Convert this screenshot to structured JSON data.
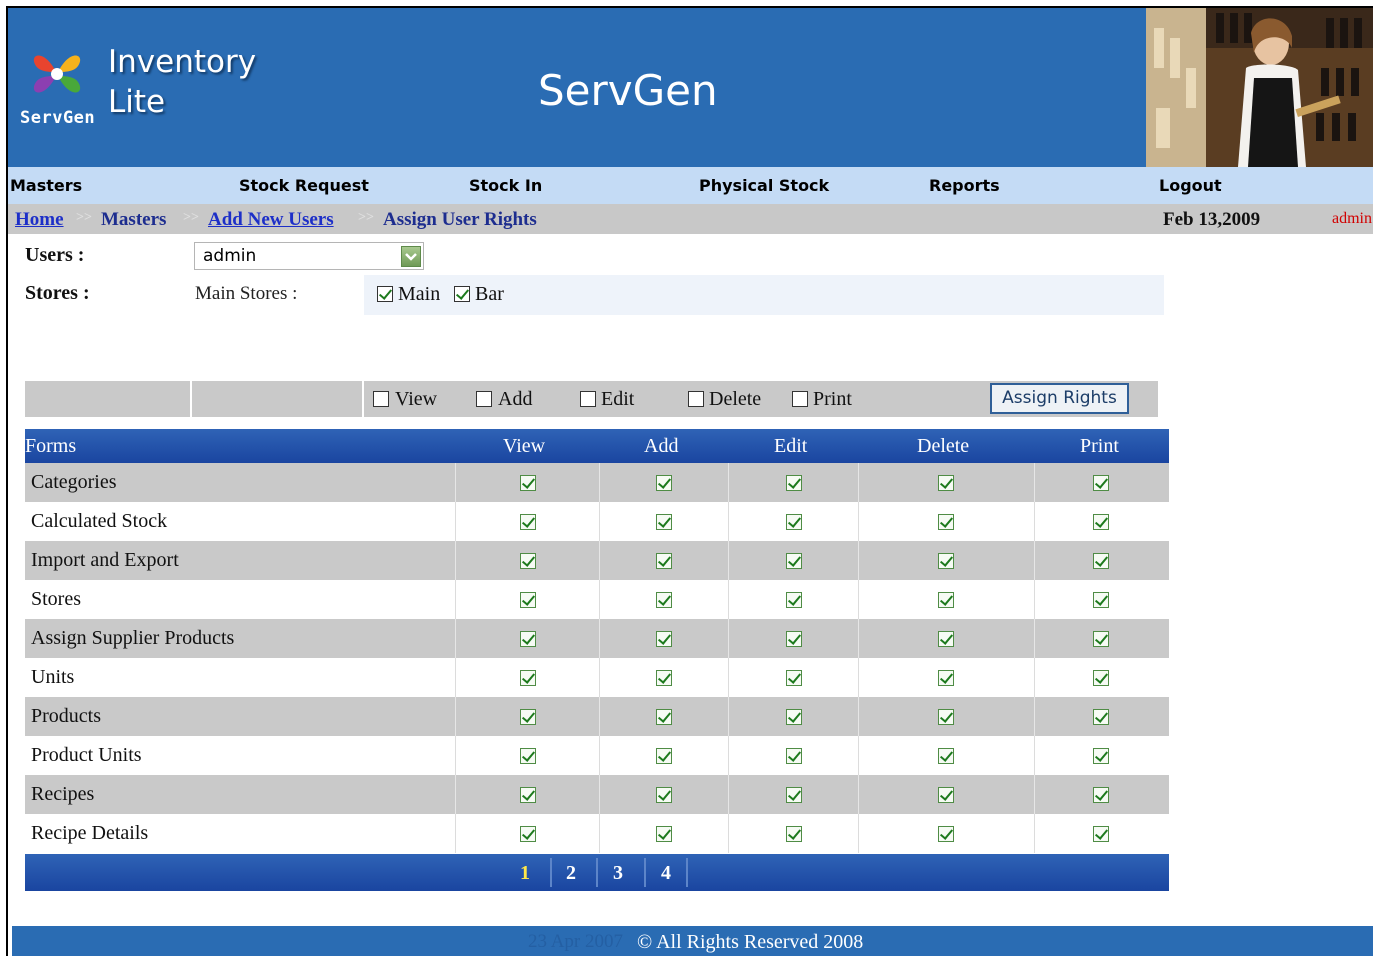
{
  "header": {
    "logo_brand": "ServGen",
    "product_line1": "Inventory",
    "product_line2": "Lite",
    "title": "ServGen"
  },
  "nav": {
    "items": [
      {
        "label": "Masters"
      },
      {
        "label": "Stock Request"
      },
      {
        "label": "Stock In"
      },
      {
        "label": "Physical Stock"
      },
      {
        "label": "Reports"
      },
      {
        "label": "Logout"
      }
    ]
  },
  "breadcrumb": {
    "home": "Home",
    "masters": "Masters",
    "add_new_users": "Add New Users",
    "current": "Assign User Rights",
    "separator": ">>",
    "date": "Feb 13,2009",
    "user": "admin"
  },
  "form": {
    "users_label": "Users :",
    "users_value": "admin",
    "stores_label": "Stores :",
    "main_stores_label": "Main Stores :",
    "stores": [
      {
        "label": "Main",
        "checked": true
      },
      {
        "label": "Bar",
        "checked": true
      }
    ]
  },
  "actions": {
    "view": "View",
    "add": "Add",
    "edit": "Edit",
    "delete": "Delete",
    "print": "Print",
    "assign_rights": "Assign Rights"
  },
  "table": {
    "headers": [
      "Forms",
      "View",
      "Add",
      "Edit",
      "Delete",
      "Print"
    ],
    "rows": [
      {
        "form": "Categories",
        "view": true,
        "add": true,
        "edit": true,
        "delete": true,
        "print": true
      },
      {
        "form": "Calculated Stock",
        "view": true,
        "add": true,
        "edit": true,
        "delete": true,
        "print": true
      },
      {
        "form": "Import and Export",
        "view": true,
        "add": true,
        "edit": true,
        "delete": true,
        "print": true
      },
      {
        "form": "Stores",
        "view": true,
        "add": true,
        "edit": true,
        "delete": true,
        "print": true
      },
      {
        "form": "Assign Supplier Products",
        "view": true,
        "add": true,
        "edit": true,
        "delete": true,
        "print": true
      },
      {
        "form": "Units",
        "view": true,
        "add": true,
        "edit": true,
        "delete": true,
        "print": true
      },
      {
        "form": "Products",
        "view": true,
        "add": true,
        "edit": true,
        "delete": true,
        "print": true
      },
      {
        "form": "Product Units",
        "view": true,
        "add": true,
        "edit": true,
        "delete": true,
        "print": true
      },
      {
        "form": "Recipes",
        "view": true,
        "add": true,
        "edit": true,
        "delete": true,
        "print": true
      },
      {
        "form": "Recipe Details",
        "view": true,
        "add": true,
        "edit": true,
        "delete": true,
        "print": true
      }
    ]
  },
  "pager": {
    "pages": [
      "1",
      "2",
      "3",
      "4"
    ],
    "current": "1"
  },
  "footer": {
    "ghost_text": "23 Apr 2007",
    "text": "© All Rights Reserved 2008"
  },
  "colors": {
    "header_bg": "#2a6cb3",
    "nav_bg": "#c4dbf5",
    "table_header_bg": "#1a45a0",
    "current_page": "#ffe84a",
    "user_text": "#d10000"
  }
}
